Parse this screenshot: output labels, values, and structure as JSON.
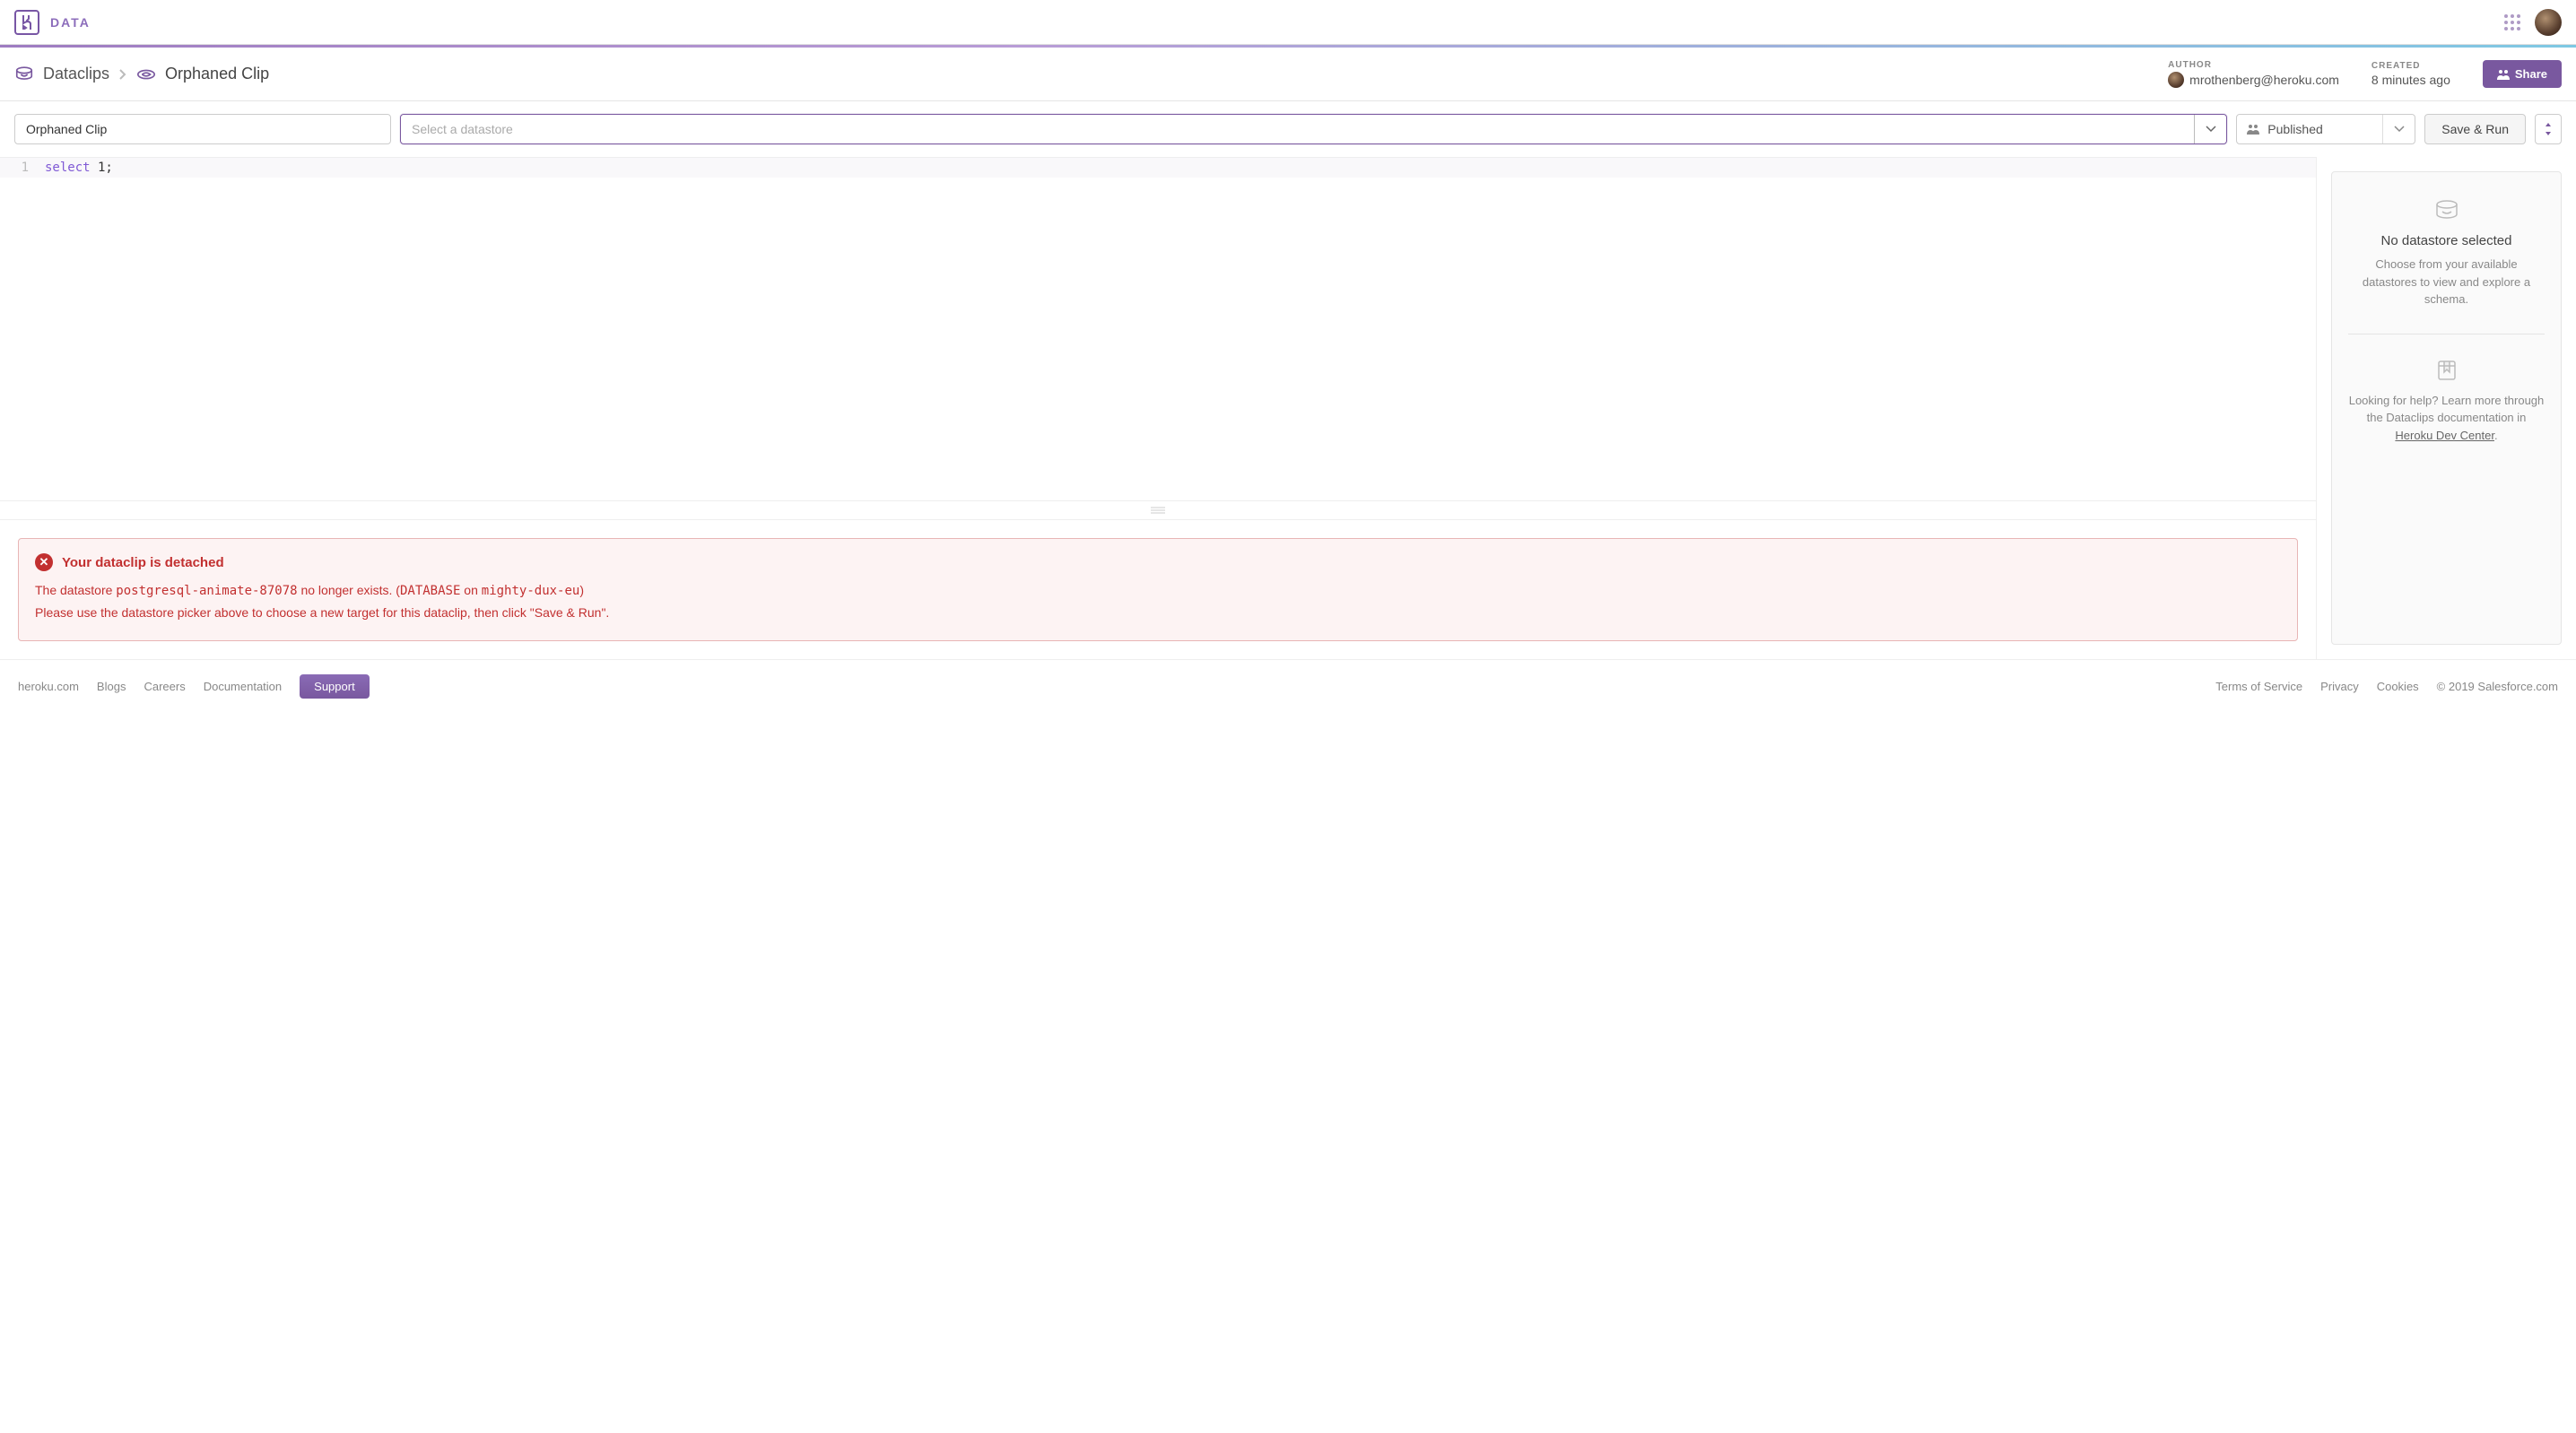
{
  "header": {
    "product": "DATA"
  },
  "breadcrumb": {
    "root": "Dataclips",
    "current": "Orphaned Clip"
  },
  "meta": {
    "author_label": "AUTHOR",
    "author_email": "mrothenberg@heroku.com",
    "created_label": "CREATED",
    "created_value": "8 minutes ago"
  },
  "share_button": "Share",
  "toolbar": {
    "title_value": "Orphaned Clip",
    "datastore_placeholder": "Select a datastore",
    "published_label": "Published",
    "save_run_label": "Save & Run"
  },
  "editor": {
    "line_number": "1",
    "code_keyword": "select",
    "code_rest": " 1;"
  },
  "error": {
    "title": "Your dataclip is detached",
    "line1_prefix": "The datastore ",
    "line1_db": "postgresql-animate-87078",
    "line1_mid": " no longer exists. (",
    "line1_var": "DATABASE",
    "line1_on": " on ",
    "line1_app": "mighty-dux-eu",
    "line1_suffix": ")",
    "line2": "Please use the datastore picker above to choose a new target for this dataclip, then click \"Save & Run\"."
  },
  "sidebar": {
    "no_ds_title": "No datastore selected",
    "no_ds_desc": "Choose from your available datastores to view and explore a schema.",
    "help_prefix": "Looking for help? Learn more through the Dataclips documentation in ",
    "help_link": "Heroku Dev Center",
    "help_suffix": "."
  },
  "footer": {
    "left": [
      "heroku.com",
      "Blogs",
      "Careers",
      "Documentation"
    ],
    "support": "Support",
    "right": [
      "Terms of Service",
      "Privacy",
      "Cookies"
    ],
    "copyright": "© 2019 Salesforce.com"
  }
}
